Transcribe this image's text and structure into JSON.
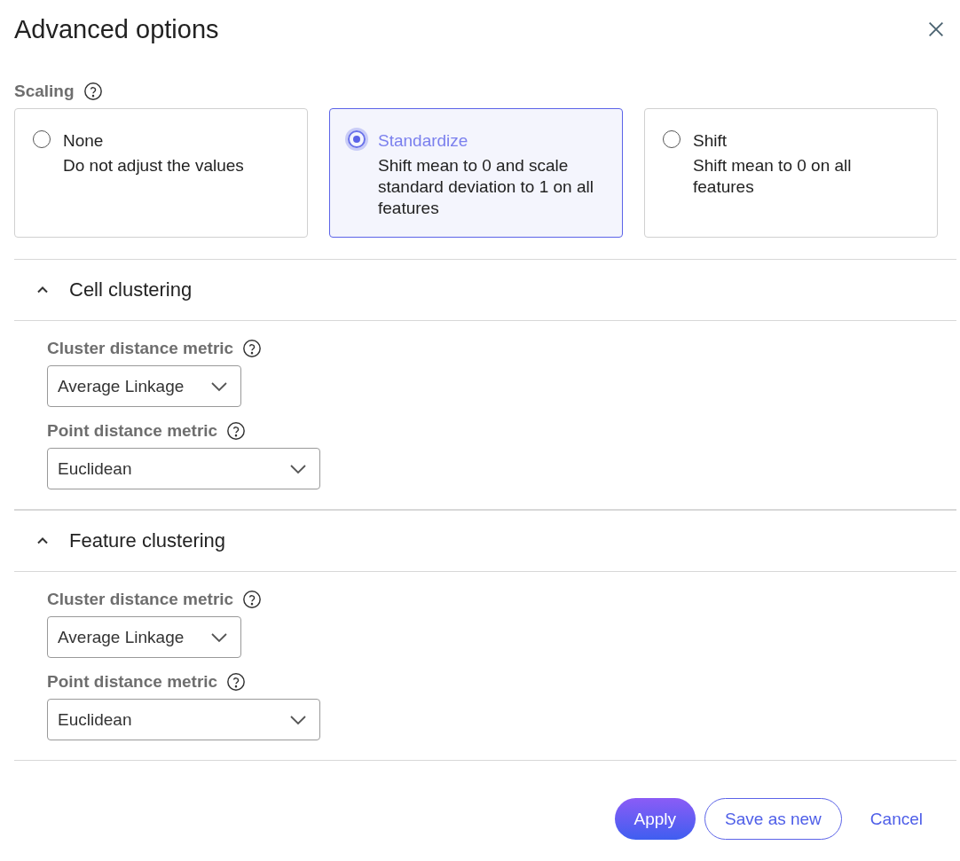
{
  "dialog": {
    "title": "Advanced options"
  },
  "scaling": {
    "label": "Scaling",
    "options": [
      {
        "title": "None",
        "description": "Do not adjust the values",
        "selected": false
      },
      {
        "title": "Standardize",
        "description": "Shift mean to 0 and scale standard deviation to 1 on all features",
        "selected": true
      },
      {
        "title": "Shift",
        "description": "Shift mean to 0 on all features",
        "selected": false
      }
    ]
  },
  "sections": [
    {
      "title": "Cell clustering",
      "expanded": true,
      "fields": [
        {
          "label": "Cluster distance metric",
          "value": "Average Linkage"
        },
        {
          "label": "Point distance metric",
          "value": "Euclidean"
        }
      ]
    },
    {
      "title": "Feature clustering",
      "expanded": true,
      "fields": [
        {
          "label": "Cluster distance metric",
          "value": "Average Linkage"
        },
        {
          "label": "Point distance metric",
          "value": "Euclidean"
        }
      ]
    }
  ],
  "buttons": [
    {
      "label": "Apply",
      "kind": "primary"
    },
    {
      "label": "Save as new",
      "kind": "outline"
    },
    {
      "label": "Cancel",
      "kind": "text"
    }
  ]
}
